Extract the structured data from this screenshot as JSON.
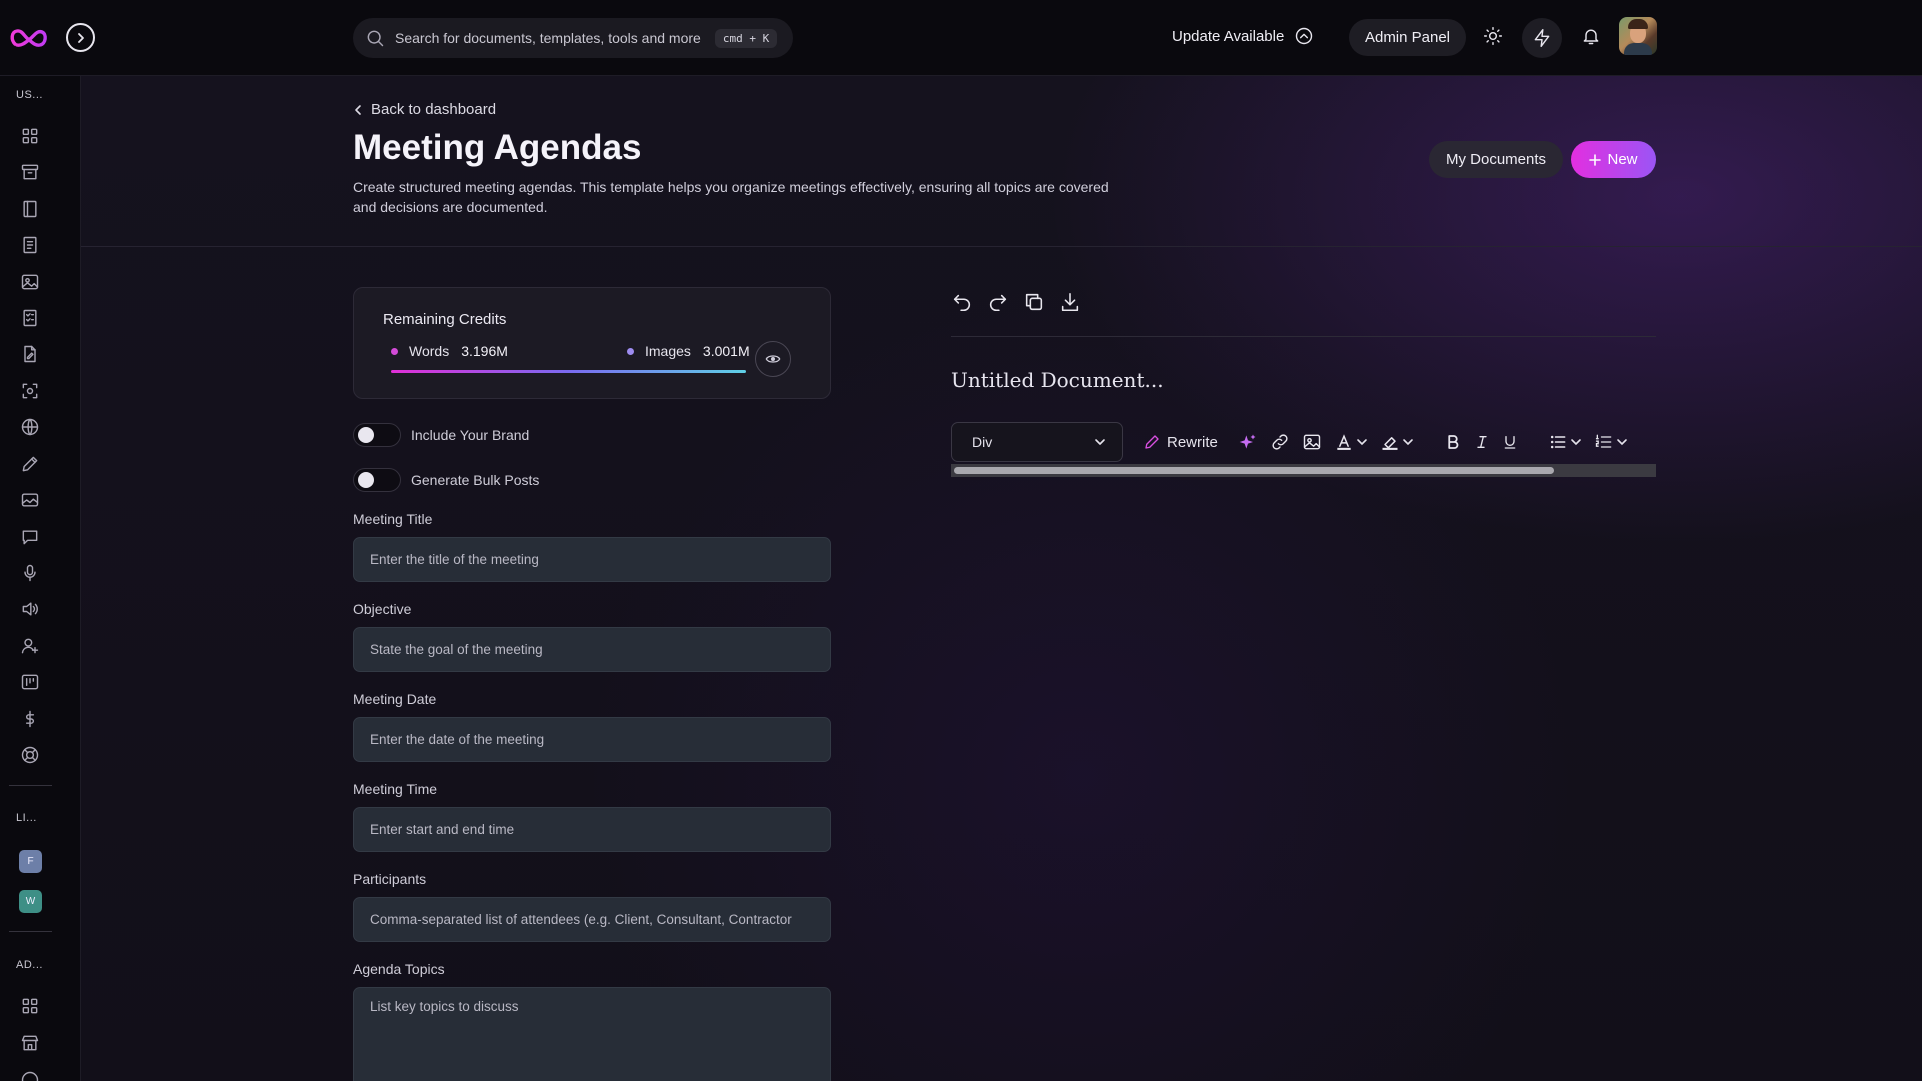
{
  "topbar": {
    "search_placeholder": "Search for documents, templates, tools and more",
    "search_shortcut": "cmd + K",
    "update_label": "Update Available",
    "admin_label": "Admin Panel"
  },
  "sidebar": {
    "section_user": "US...",
    "section_links": "LI...",
    "section_admin": "AD...",
    "workspaces": [
      {
        "letter": "F",
        "color": "#6d7fa8"
      },
      {
        "letter": "W",
        "color": "#3e8f86"
      }
    ],
    "icons": [
      "dashboard-icon",
      "archive-icon",
      "book-icon",
      "document-icon",
      "image-icon",
      "checklist-icon",
      "file-edit-icon",
      "scan-icon",
      "globe-icon",
      "pen-icon",
      "gallery-icon",
      "chat-icon",
      "microphone-icon",
      "speaker-icon",
      "user-plus-icon",
      "kanban-icon",
      "dollar-icon",
      "support-icon"
    ]
  },
  "header": {
    "back_label": "Back to dashboard",
    "title": "Meeting Agendas",
    "description": "Create structured meeting agendas. This template helps you organize meetings effectively, ensuring all topics are covered and decisions are documented.",
    "my_documents_label": "My Documents",
    "new_label": "New"
  },
  "credits": {
    "title": "Remaining Credits",
    "words_label": "Words",
    "words_value": "3.196M",
    "words_color": "#d34bd8",
    "images_label": "Images",
    "images_value": "3.001M",
    "images_color": "#9d8cf0"
  },
  "toggles": {
    "brand_label": "Include Your Brand",
    "bulk_label": "Generate Bulk Posts"
  },
  "form": {
    "title_label": "Meeting Title",
    "title_placeholder": "Enter the title of the meeting",
    "objective_label": "Objective",
    "objective_placeholder": "State the goal of the meeting",
    "date_label": "Meeting Date",
    "date_placeholder": "Enter the date of the meeting",
    "time_label": "Meeting Time",
    "time_placeholder": "Enter start and end time",
    "participants_label": "Participants",
    "participants_placeholder": "Comma-separated list of attendees (e.g. Client, Consultant, Contractor",
    "topics_label": "Agenda Topics",
    "topics_placeholder": "List key topics to discuss"
  },
  "editor": {
    "doc_title": "Untitled Document...",
    "block_type": "Div",
    "rewrite_label": "Rewrite"
  }
}
